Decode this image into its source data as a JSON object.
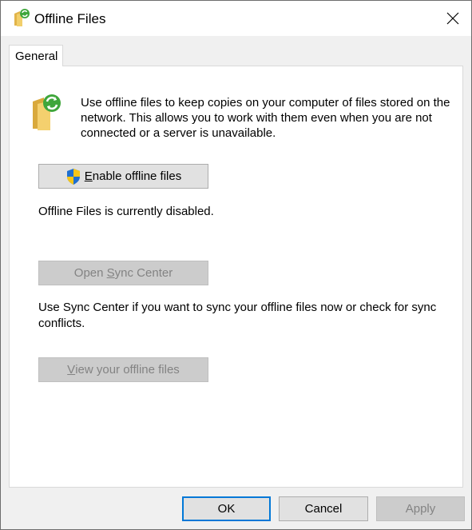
{
  "window": {
    "title": "Offline Files"
  },
  "tabs": [
    {
      "label": "General"
    }
  ],
  "general": {
    "intro_text": "Use offline files to keep copies on your computer of files stored on the network.  This allows you to work with them even when you are not connected or a server is unavailable.",
    "enable_button": {
      "accel": "E",
      "rest": "nable offline files"
    },
    "status_text": "Offline Files is currently disabled.",
    "sync_center_button": {
      "before": "Open ",
      "accel": "S",
      "rest": "ync Center"
    },
    "sync_text": "Use Sync Center if you want to sync your offline files now or check for sync conflicts.",
    "view_files_button": {
      "accel": "V",
      "rest": "iew your offline files"
    }
  },
  "footer": {
    "ok_label": "OK",
    "cancel_label": "Cancel",
    "apply_label": "Apply"
  },
  "colors": {
    "accent": "#0078d7",
    "folder": "#e8c158",
    "sync_green": "#3fa63b"
  }
}
